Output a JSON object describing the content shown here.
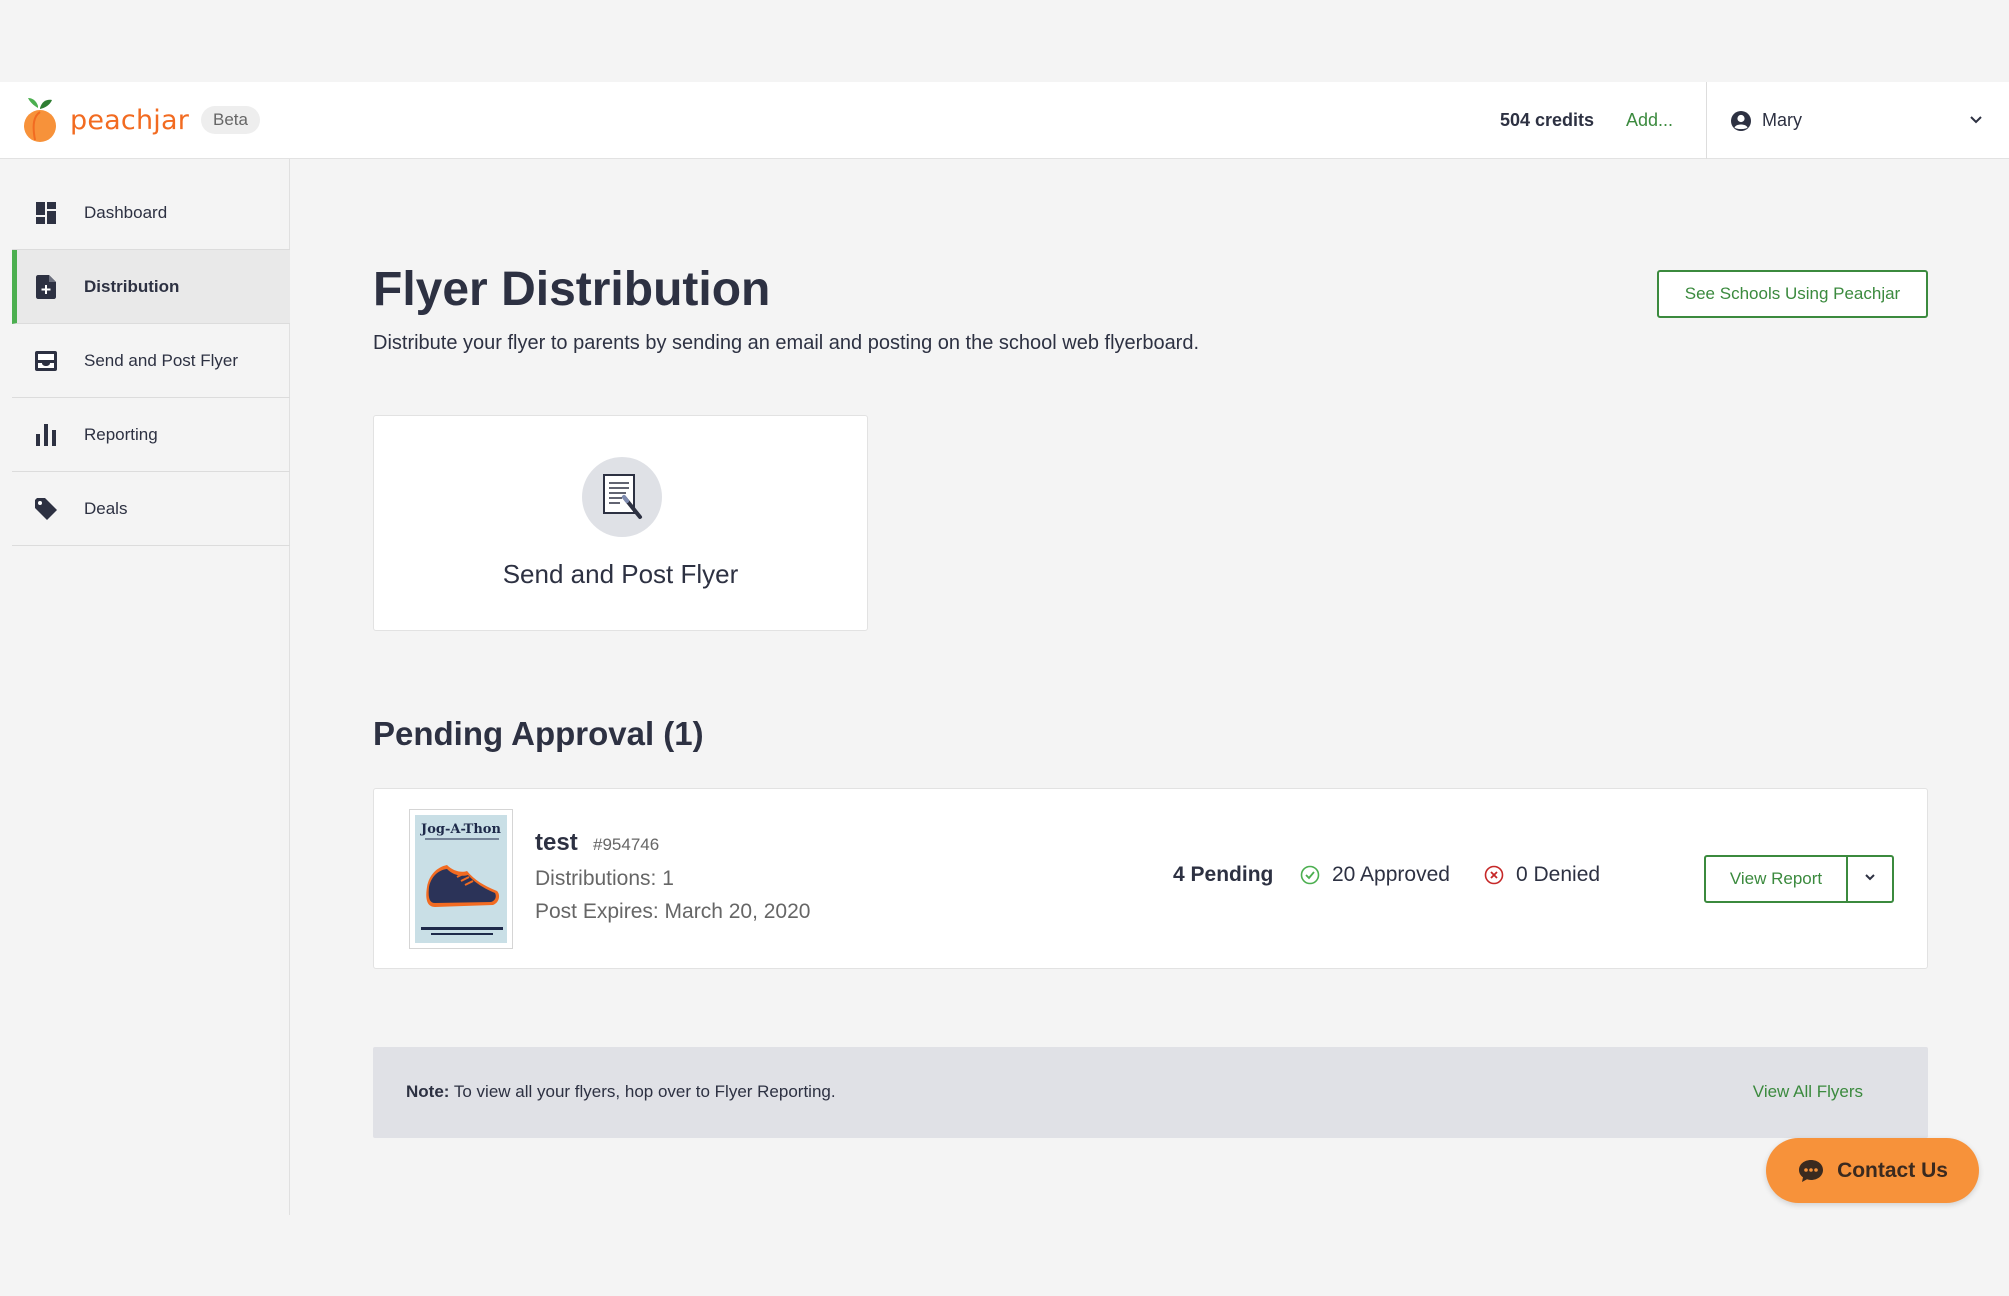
{
  "header": {
    "brand": "peachjar",
    "badge": "Beta",
    "credits": "504 credits",
    "add_label": "Add...",
    "user_name": "Mary"
  },
  "sidebar": {
    "items": [
      {
        "label": "Dashboard",
        "icon": "dashboard-icon"
      },
      {
        "label": "Distribution",
        "icon": "add-document-icon",
        "active": true
      },
      {
        "label": "Send and Post Flyer",
        "icon": "inbox-icon"
      },
      {
        "label": "Reporting",
        "icon": "bar-chart-icon"
      },
      {
        "label": "Deals",
        "icon": "tag-icon"
      }
    ]
  },
  "main": {
    "title": "Flyer Distribution",
    "subtitle": "Distribute your flyer to parents by sending an email and posting on the school web flyerboard.",
    "see_schools_label": "See Schools Using Peachjar",
    "send_card_label": "Send and Post Flyer",
    "pending_title": "Pending Approval (1)",
    "flyer": {
      "thumb_title": "Jog-A-Thon",
      "name": "test",
      "id": "#954746",
      "distributions": "Distributions: 1",
      "expires": "Post Expires: March 20, 2020",
      "pending": "4 Pending",
      "approved": "20 Approved",
      "denied": "0 Denied",
      "view_report_label": "View Report"
    },
    "note": {
      "label": "Note:",
      "text": "To view all your flyers, hop over to Flyer Reporting.",
      "link": "View All Flyers"
    },
    "contact_label": "Contact Us"
  },
  "colors": {
    "brand_orange": "#f26b21",
    "accent_green": "#3b8a3e",
    "active_bar": "#4caf50",
    "denied_red": "#c62828",
    "contact_orange": "#f7923a"
  }
}
